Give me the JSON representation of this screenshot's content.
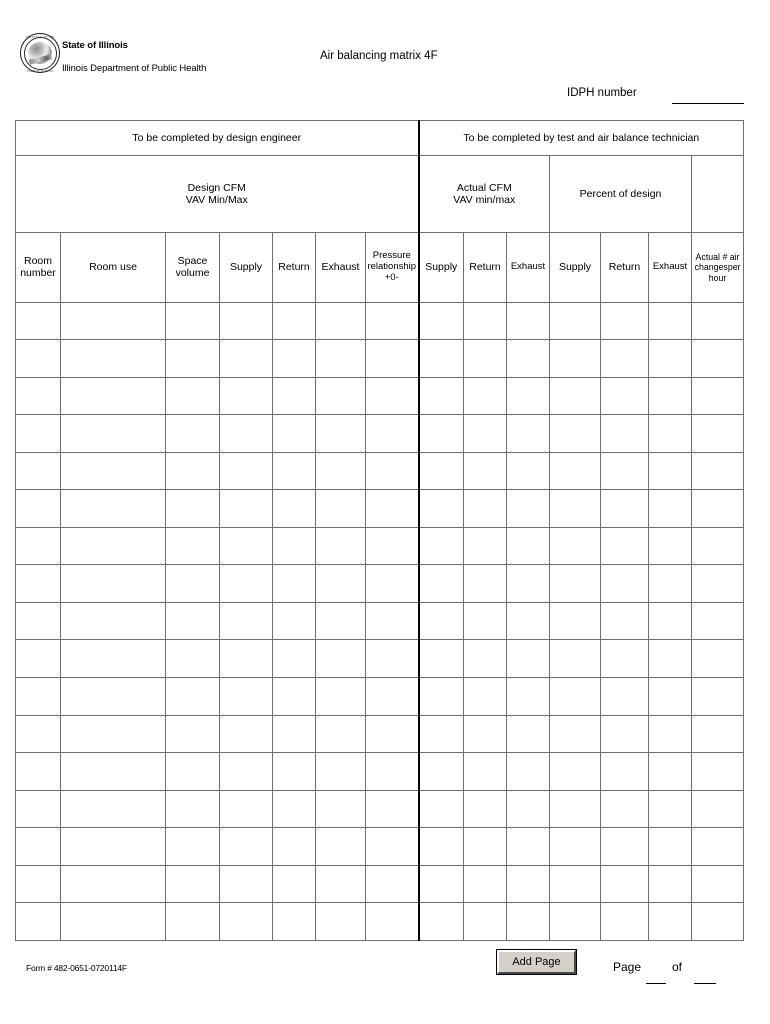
{
  "header": {
    "seal": {
      "top_text": "GREAT SEAL OF THE",
      "bottom_text": "STATE OF ILLINOIS"
    },
    "org_name": "State of Illinois",
    "org_subtitle": "Illinois Department of Public Health",
    "doc_title": "Air balancing matrix  4F",
    "idph_label": "IDPH number"
  },
  "table": {
    "bands": {
      "left_band": "To be completed by  design engineer",
      "right_band": "To be completed by test and air balance technician",
      "design_cfm": "Design CFM\nVAV Min/Max",
      "design_cfm_line1": "Design CFM",
      "design_cfm_line2": "VAV Min/Max",
      "actual_cfm_line1": "Actual CFM",
      "actual_cfm_line2": "VAV min/max",
      "percent_of_design": "Percent of design"
    },
    "columns": [
      {
        "id": "room-number",
        "line1": "Room",
        "line2": "number"
      },
      {
        "id": "room-use",
        "line1": "Room use",
        "line2": ""
      },
      {
        "id": "space-volume",
        "line1": "Space",
        "line2": "volume"
      },
      {
        "id": "design-supply",
        "line1": "Supply",
        "line2": ""
      },
      {
        "id": "design-return",
        "line1": "Return",
        "line2": ""
      },
      {
        "id": "design-exhaust",
        "line1": "Exhaust",
        "line2": ""
      },
      {
        "id": "pressure-relationship",
        "line1": "Pressure",
        "line2": "relationship",
        "line3": "+0-"
      },
      {
        "id": "actual-supply",
        "line1": "Supply",
        "line2": ""
      },
      {
        "id": "actual-return",
        "line1": "Return",
        "line2": ""
      },
      {
        "id": "actual-exhaust",
        "line1": "Exhaust",
        "line2": ""
      },
      {
        "id": "percent-supply",
        "line1": "Supply",
        "line2": ""
      },
      {
        "id": "percent-return",
        "line1": "Return",
        "line2": ""
      },
      {
        "id": "percent-exhaust",
        "line1": "Exhaust",
        "line2": ""
      },
      {
        "id": "air-changes",
        "line1": "Actual  # air",
        "line2": "changesper",
        "line3": "hour"
      }
    ],
    "row_count": 17,
    "rows": [
      [
        "",
        "",
        "",
        "",
        "",
        "",
        "",
        "",
        "",
        "",
        "",
        "",
        "",
        ""
      ],
      [
        "",
        "",
        "",
        "",
        "",
        "",
        "",
        "",
        "",
        "",
        "",
        "",
        "",
        ""
      ],
      [
        "",
        "",
        "",
        "",
        "",
        "",
        "",
        "",
        "",
        "",
        "",
        "",
        "",
        ""
      ],
      [
        "",
        "",
        "",
        "",
        "",
        "",
        "",
        "",
        "",
        "",
        "",
        "",
        "",
        ""
      ],
      [
        "",
        "",
        "",
        "",
        "",
        "",
        "",
        "",
        "",
        "",
        "",
        "",
        "",
        ""
      ],
      [
        "",
        "",
        "",
        "",
        "",
        "",
        "",
        "",
        "",
        "",
        "",
        "",
        "",
        ""
      ],
      [
        "",
        "",
        "",
        "",
        "",
        "",
        "",
        "",
        "",
        "",
        "",
        "",
        "",
        ""
      ],
      [
        "",
        "",
        "",
        "",
        "",
        "",
        "",
        "",
        "",
        "",
        "",
        "",
        "",
        ""
      ],
      [
        "",
        "",
        "",
        "",
        "",
        "",
        "",
        "",
        "",
        "",
        "",
        "",
        "",
        ""
      ],
      [
        "",
        "",
        "",
        "",
        "",
        "",
        "",
        "",
        "",
        "",
        "",
        "",
        "",
        ""
      ],
      [
        "",
        "",
        "",
        "",
        "",
        "",
        "",
        "",
        "",
        "",
        "",
        "",
        "",
        ""
      ],
      [
        "",
        "",
        "",
        "",
        "",
        "",
        "",
        "",
        "",
        "",
        "",
        "",
        "",
        ""
      ],
      [
        "",
        "",
        "",
        "",
        "",
        "",
        "",
        "",
        "",
        "",
        "",
        "",
        "",
        ""
      ],
      [
        "",
        "",
        "",
        "",
        "",
        "",
        "",
        "",
        "",
        "",
        "",
        "",
        "",
        ""
      ],
      [
        "",
        "",
        "",
        "",
        "",
        "",
        "",
        "",
        "",
        "",
        "",
        "",
        "",
        ""
      ],
      [
        "",
        "",
        "",
        "",
        "",
        "",
        "",
        "",
        "",
        "",
        "",
        "",
        "",
        ""
      ],
      [
        "",
        "",
        "",
        "",
        "",
        "",
        "",
        "",
        "",
        "",
        "",
        "",
        "",
        ""
      ]
    ]
  },
  "footer": {
    "form_number": "Form # 482-0651-0720114F",
    "add_page_button": "Add Page",
    "page_label": "Page",
    "of_label": "of",
    "page_value": "",
    "page_total_value": ""
  },
  "colors": {
    "grid_line": "#6f6f6f",
    "heavy_divider": "#000000",
    "button_face": "#d4d0c8",
    "page_background": "#ffffff"
  }
}
